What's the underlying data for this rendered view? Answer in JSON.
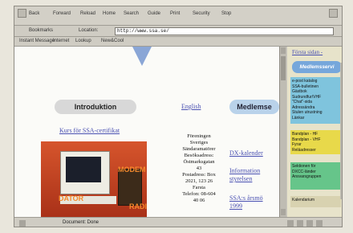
{
  "browser": {
    "menu": [
      "Back",
      "Forward",
      "Reload",
      "Home",
      "Search",
      "Guide",
      "Print",
      "Security",
      "Stop"
    ],
    "bookmarks_label": "Bookmarks",
    "location_label": "Location:",
    "url": "http://www.ssa.se/",
    "links": [
      "Instant Message",
      "Internet",
      "Lookup",
      "New&Cool"
    ],
    "status": "Document: Done"
  },
  "page": {
    "intro": "Introduktion",
    "english": "English",
    "medl": "Medlemse",
    "kurs": "Kurs för SSA-certifikat",
    "photo_labels": {
      "modem": "MODEM",
      "dator": "DATOR",
      "radio": "RADIO"
    },
    "address_lines": [
      "Föreningen",
      "Sveriges",
      "Sändaramatörer",
      "Besöksadress:",
      "Östmarksgatan",
      "43",
      "Postadress: Box",
      "2021, 123 26",
      "Farsta",
      "Telefon: 08-604",
      "40 06"
    ],
    "links": [
      "DX-kalender",
      "Information",
      "styrelsen",
      "SSA:s årsmö",
      "1999"
    ]
  },
  "sidebar": {
    "first_link": "Första sidan -",
    "header": "Medlemsservi",
    "blue_items": [
      "e-post katalog",
      "SSA-bulletinen",
      "Gästbok",
      "Sudrundfur/VHF",
      "\"Chat\"-sida",
      "Adressändra",
      "Stulen utrustning",
      "Länkar"
    ],
    "yellow_items": [
      "Bandplan - HF",
      "Bandplan - VHF",
      "Fyrar",
      "Reläadresser"
    ],
    "green_items": [
      "Sektionen för",
      "DXCC-länder",
      "Ansvarsgruppen"
    ],
    "bottom_item": "Kalendarium"
  }
}
